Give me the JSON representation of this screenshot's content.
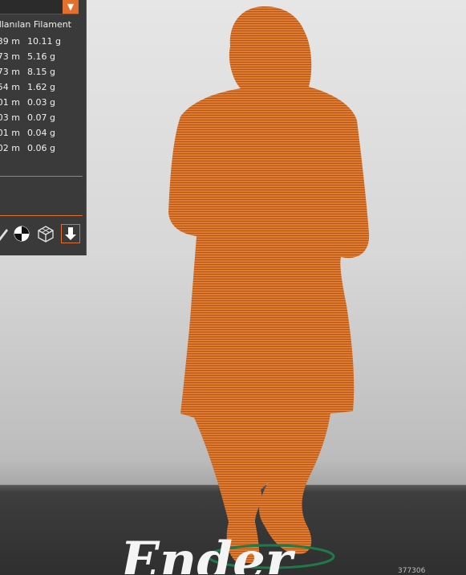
{
  "panel": {
    "dropdown_icon": "triangle-down-icon",
    "header": "Kullanılan Filament",
    "rows": [
      {
        "length": "39 m",
        "weight": "10.11 g"
      },
      {
        "length": "73 m",
        "weight": "5.16 g"
      },
      {
        "length": "73 m",
        "weight": "8.15 g"
      },
      {
        "length": "54 m",
        "weight": "1.62 g"
      },
      {
        "length": "01 m",
        "weight": "0.03 g"
      },
      {
        "length": "03 m",
        "weight": "0.07 g"
      },
      {
        "length": "01 m",
        "weight": "0.04 g"
      },
      {
        "length": "02 m",
        "weight": "0.06 g"
      }
    ]
  },
  "toolbar": {
    "icons": [
      "pencil-icon",
      "contrast-circle-icon",
      "cube-wireframe-icon",
      "download-arrow-icon"
    ]
  },
  "scene": {
    "model_color": "#e07a2f",
    "brand_overlay_text": "Ender",
    "corner_text": "377306"
  },
  "colors": {
    "accent": "#e2702c",
    "panel_bg": "#3a3a3a"
  }
}
